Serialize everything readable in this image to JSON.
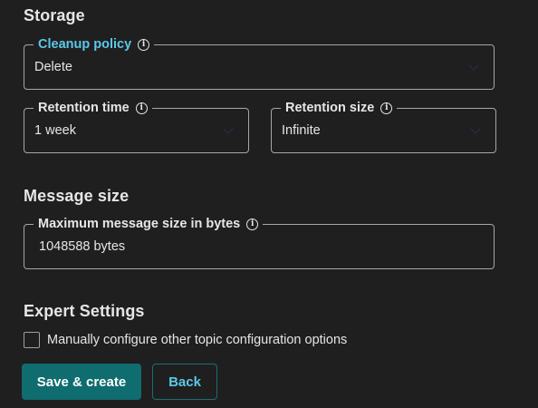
{
  "storage": {
    "title": "Storage",
    "cleanup_policy": {
      "label": "Cleanup policy",
      "value": "Delete"
    },
    "retention_time": {
      "label": "Retention time",
      "value": "1 week"
    },
    "retention_size": {
      "label": "Retention size",
      "value": "Infinite"
    }
  },
  "message_size": {
    "title": "Message size",
    "max_bytes": {
      "label": "Maximum message size in bytes",
      "value": "1048588 bytes"
    }
  },
  "expert": {
    "title": "Expert Settings",
    "checkbox_label": "Manually configure other topic configuration options",
    "checked": false
  },
  "actions": {
    "save_label": "Save & create",
    "back_label": "Back"
  },
  "colors": {
    "background": "#1f1f1f",
    "accent": "#5cc8e8",
    "primary_button": "#0f6c6f",
    "border": "#a7a7a7"
  },
  "icons": {
    "info": "info-icon",
    "dropdown": "chevron-down-icon"
  }
}
